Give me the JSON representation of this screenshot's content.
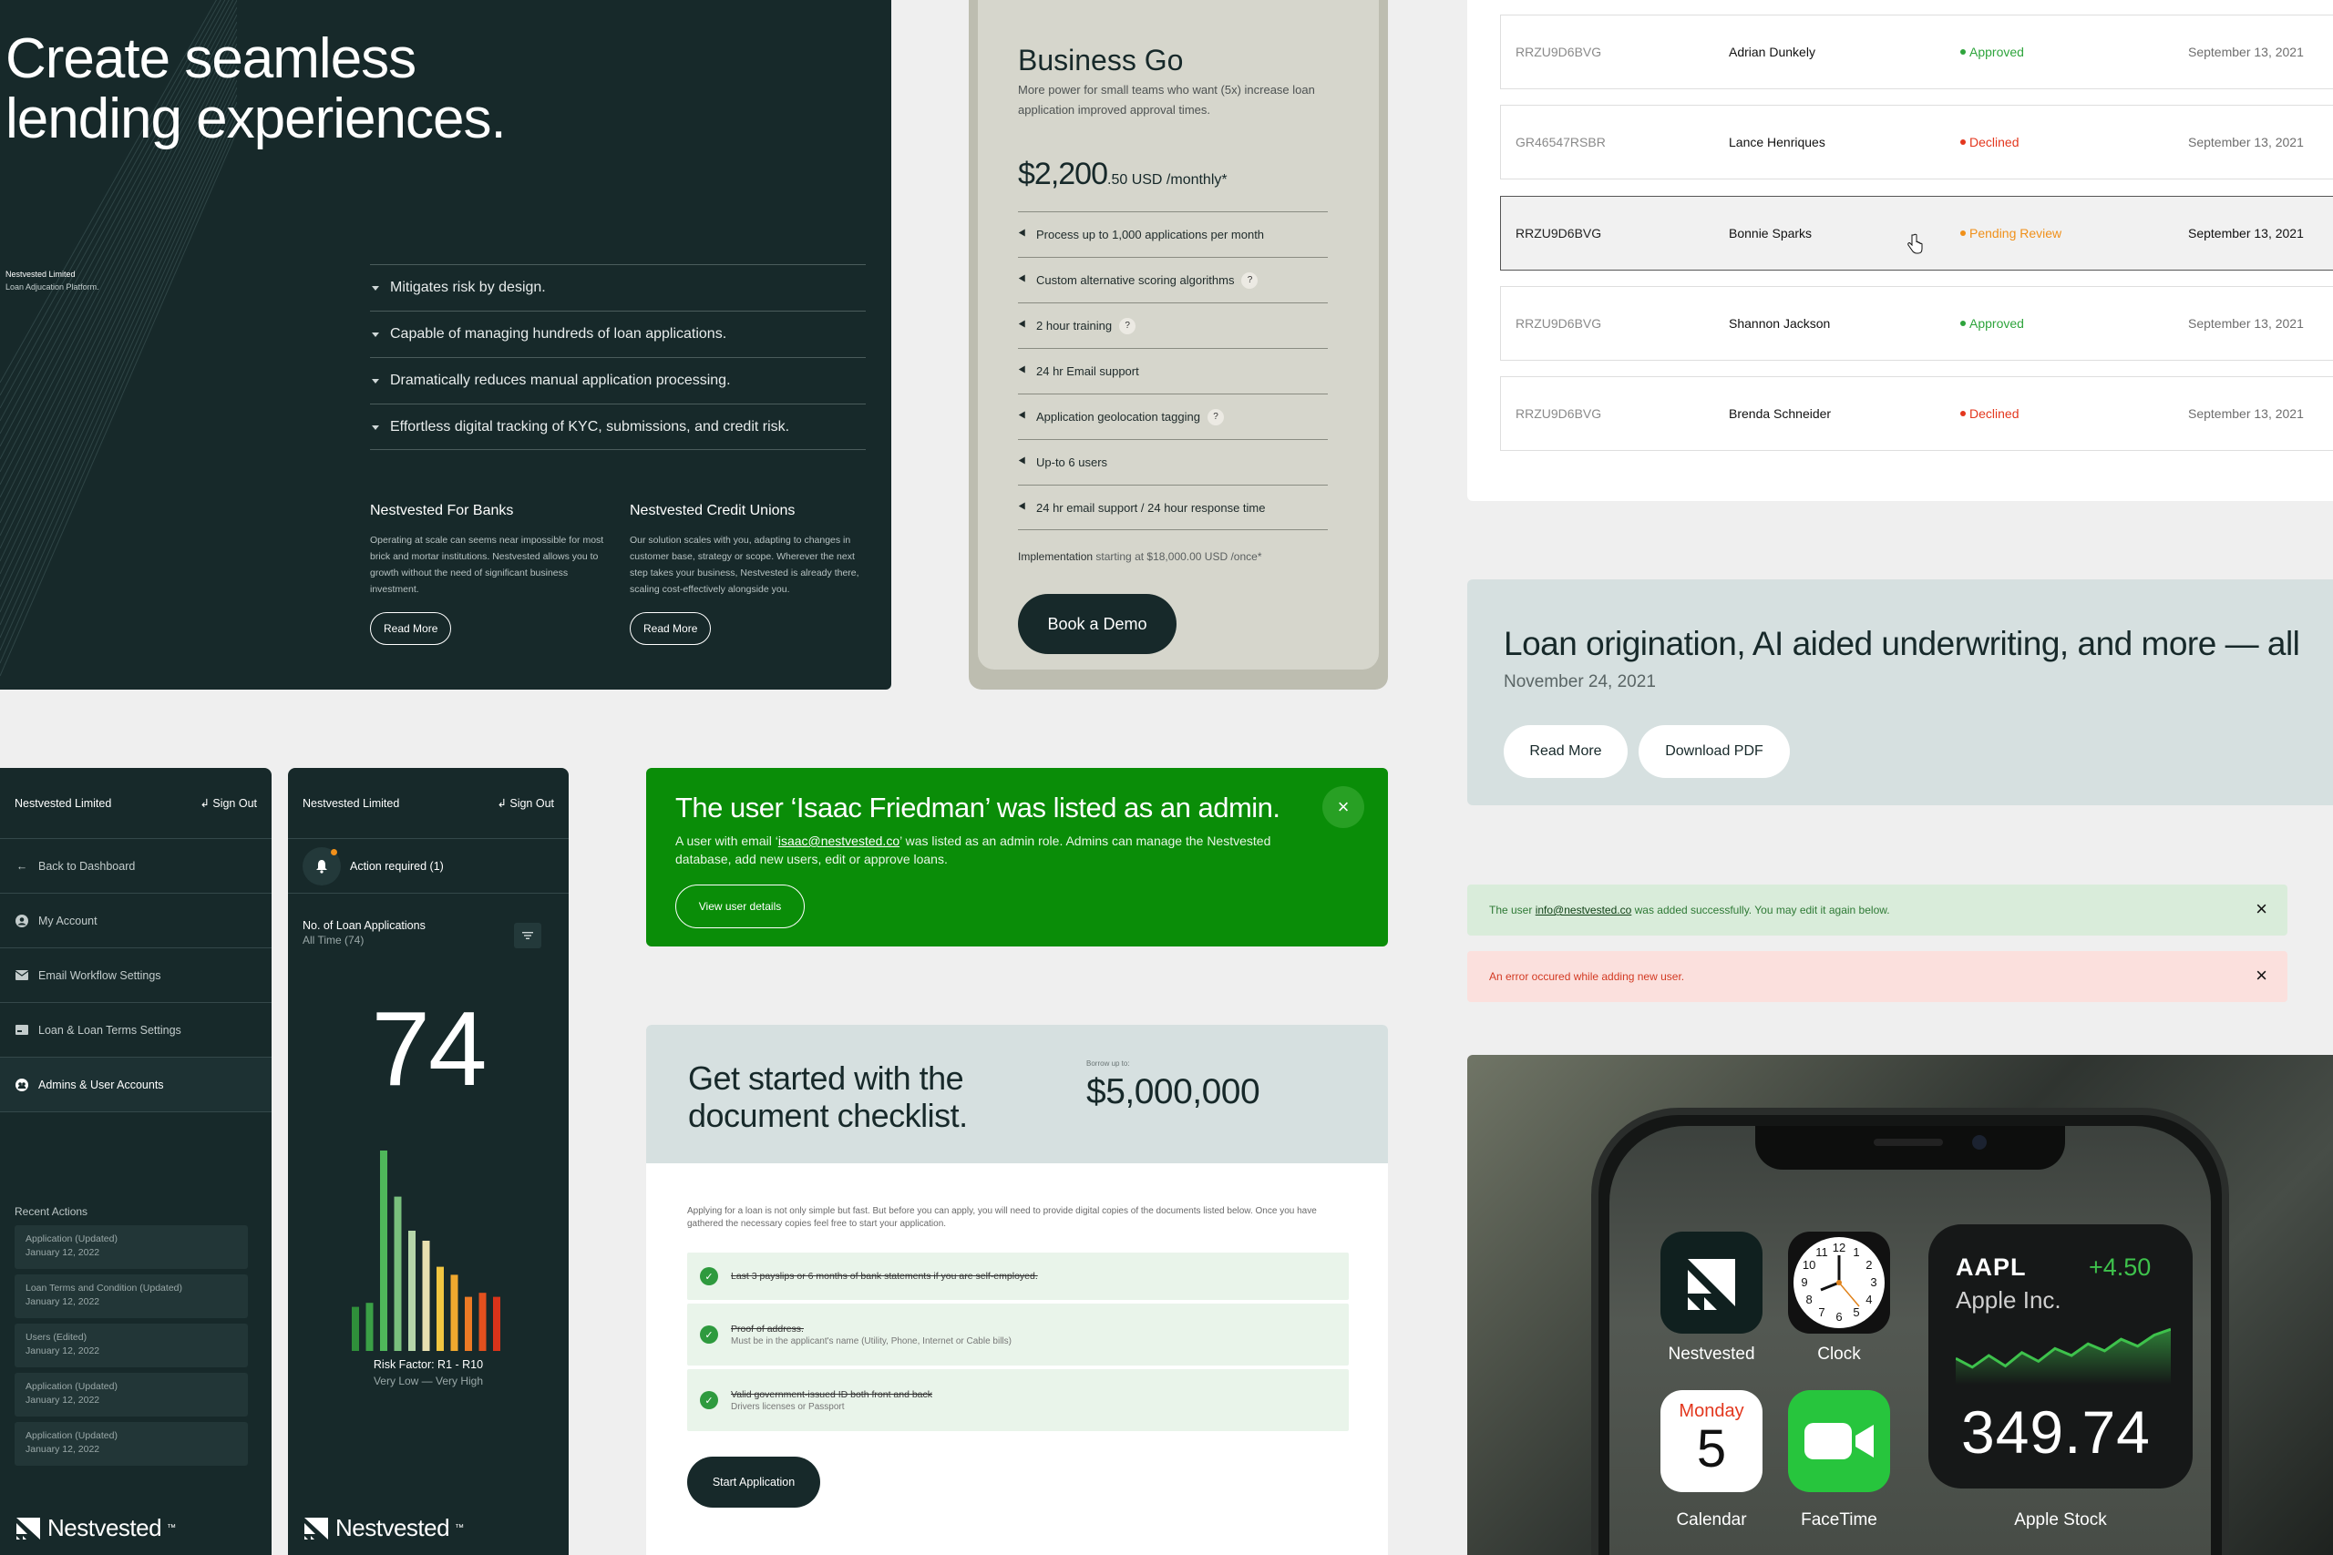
{
  "hero": {
    "title_line1": "Create seamless",
    "title_line2": "lending experiences.",
    "company": "Nestvested Limited",
    "tagline": "Loan Adjucation Platform.",
    "features": [
      "Mitigates risk by design.",
      "Capable of managing hundreds of loan applications.",
      "Dramatically reduces manual application processing.",
      "Effortless digital tracking of KYC, submissions, and credit risk."
    ],
    "banks": {
      "title": "Nestvested For Banks",
      "text": "Operating at scale can seems near impossible for most brick and mortar institutions. Nestvested allows you to growth without the need of significant business investment.",
      "button": "Read More"
    },
    "unions": {
      "title": "Nestvested Credit Unions",
      "text": "Our solution scales with you, adapting to changes in customer base, strategy or scope. Wherever the next step takes your business, Nestvested is already there, scaling cost-effectively alongside you.",
      "button": "Read More"
    }
  },
  "pricing": {
    "name": "Business Go",
    "desc": "More power for small teams who want (5x) increase loan application improved approval times.",
    "price": "$2,200",
    "price_cents": ".50 USD /monthly*",
    "items": [
      {
        "label": "Process up to 1,000 applications per month",
        "help": ""
      },
      {
        "label": "Custom alternative scoring algorithms",
        "help": "?"
      },
      {
        "label": "2 hour training",
        "help": "?"
      },
      {
        "label": "24 hr Email support",
        "help": ""
      },
      {
        "label": "Application geolocation tagging",
        "help": "?"
      },
      {
        "label": "Up-to 6 users",
        "help": ""
      },
      {
        "label": "24 hr email support  / 24 hour response  time",
        "help": ""
      }
    ],
    "impl_label": "Implementation",
    "impl_value": " starting at $18,000.00 USD /once*",
    "button": "Book a Demo"
  },
  "table": {
    "rows": [
      {
        "id": "RRZU9D6BVG",
        "name": "Adrian Dunkely",
        "status": "Approved",
        "status_color": "#2ea43c",
        "date": "September 13, 2021"
      },
      {
        "id": "GR46547RSBR",
        "name": "Lance Henriques",
        "status": "Declined",
        "status_color": "#e3371e",
        "date": "September 13, 2021"
      },
      {
        "id": "RRZU9D6BVG",
        "name": "Bonnie Sparks",
        "status": "Pending Review",
        "status_color": "#f0901a",
        "date": "September 13, 2021"
      },
      {
        "id": "RRZU9D6BVG",
        "name": "Shannon Jackson",
        "status": "Approved",
        "status_color": "#2ea43c",
        "date": "September 13, 2021"
      },
      {
        "id": "RRZU9D6BVG",
        "name": "Brenda Schneider",
        "status": "Declined",
        "status_color": "#e3371e",
        "date": "September 13, 2021"
      }
    ]
  },
  "news": {
    "title": "Loan origination, AI aided underwriting, and more — all",
    "date": "November 24, 2021",
    "read_more": "Read More",
    "download": "Download PDF"
  },
  "alerts": {
    "success_pre": "The user ",
    "success_email": "info@nestvested.co",
    "success_post": " was added successfully. You may edit it again below.",
    "error": "An error occured while adding new user.",
    "close": "×"
  },
  "nav": {
    "company": "Nestvested Limited",
    "sign_out": "Sign Out",
    "items": [
      {
        "label": "Back to Dashboard"
      },
      {
        "label": "My Account"
      },
      {
        "label": "Email Workflow Settings"
      },
      {
        "label": "Loan & Loan Terms Settings"
      },
      {
        "label": "Admins & User Accounts"
      }
    ],
    "recent_title": "Recent Actions",
    "recent": [
      {
        "title": "Application (Updated)",
        "date": "January 12, 2022"
      },
      {
        "title": "Loan Terms and Condition (Updated)",
        "date": "January 12, 2022"
      },
      {
        "title": "Users (Edited)",
        "date": "January 12, 2022"
      },
      {
        "title": "Application (Updated)",
        "date": "January 12, 2022"
      },
      {
        "title": "Application (Updated)",
        "date": "January 12, 2022"
      }
    ],
    "brand": "Nestvested",
    "tm": "™"
  },
  "stats": {
    "action": "Action required (1)",
    "title": "No. of Loan Applications",
    "subtitle": "All Time (74)",
    "value": "74",
    "risk": "Risk Factor: R1 - R10",
    "risk_range": "Very Low —  Very High",
    "bars": [
      {
        "v": 0.22,
        "c": "#2f8f3a"
      },
      {
        "v": 0.24,
        "c": "#3aa046"
      },
      {
        "v": 1.0,
        "c": "#4fb75a"
      },
      {
        "v": 0.77,
        "c": "#79c07d"
      },
      {
        "v": 0.6,
        "c": "#b6d6a9"
      },
      {
        "v": 0.55,
        "c": "#e8e0b0"
      },
      {
        "v": 0.42,
        "c": "#f1c641"
      },
      {
        "v": 0.38,
        "c": "#f0a82e"
      },
      {
        "v": 0.27,
        "c": "#ec7a25"
      },
      {
        "v": 0.29,
        "c": "#e2501e"
      },
      {
        "v": 0.27,
        "c": "#d9331a"
      }
    ]
  },
  "banner": {
    "title": "The user ‘Isaac Friedman’ was listed as an admin.",
    "text_pre": "A user with email ‘",
    "email": "isaac@nestvested.co",
    "text_post": "’ was listed as an admin role. Admins can manage the Nestvested database, add new users, edit or approve loans.",
    "button": "View user details",
    "close": "×"
  },
  "checklist": {
    "title_line1": "Get started with the",
    "title_line2": "document checklist.",
    "borrow_label": "Borrow up to:",
    "borrow_value": "$5,000,000",
    "intro": "Applying for a loan is not only simple but fast. But before you can apply, you will need to provide digital copies of the documents listed below. Once you have gathered the necessary copies feel free to start your application.",
    "items": [
      {
        "title": "Last 3 payslips or 6 months of bank statements if you are self-employed.",
        "sub": ""
      },
      {
        "title": "Proof of address.",
        "sub": "Must be in the applicant's name (Utility, Phone, Internet or Cable bills)"
      },
      {
        "title": "Valid government-issued ID both front and back",
        "sub": "Drivers licenses or Passport"
      }
    ],
    "button": "Start Application"
  },
  "phone": {
    "apps": [
      {
        "label": "Nestvested"
      },
      {
        "label": "Clock"
      },
      {
        "label": "Calendar"
      },
      {
        "label": "FaceTime"
      }
    ],
    "calendar_day": "Monday",
    "calendar_date": "5",
    "stock": {
      "ticker": "AAPL",
      "change": "+4.50",
      "name": "Apple Inc.",
      "price": "349.74",
      "label": "Apple Stock",
      "series": [
        0.45,
        0.3,
        0.5,
        0.32,
        0.55,
        0.4,
        0.62,
        0.5,
        0.7,
        0.58,
        0.78,
        0.66,
        0.85,
        0.95
      ]
    },
    "clock_numbers": [
      "12",
      "1",
      "2",
      "3",
      "4",
      "5",
      "6",
      "7",
      "8",
      "9",
      "10",
      "11"
    ]
  }
}
